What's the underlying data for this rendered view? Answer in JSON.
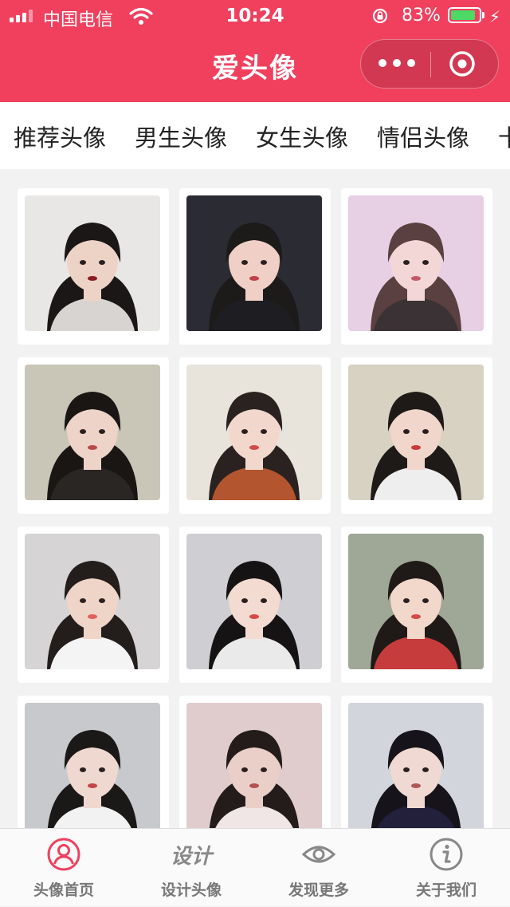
{
  "status_bar": {
    "carrier": "中国电信",
    "time": "10:24",
    "battery_percent": "83%",
    "battery_level": 0.83
  },
  "nav": {
    "title": "爱头像"
  },
  "tabs": [
    {
      "label": "推荐头像",
      "active": true
    },
    {
      "label": "男生头像",
      "active": false
    },
    {
      "label": "女生头像",
      "active": false
    },
    {
      "label": "情侣头像",
      "active": false
    },
    {
      "label": "卡",
      "active": false
    }
  ],
  "avatars": [
    {
      "name": "avatar-1",
      "bg": "#e9e7e5",
      "hair": "#1a1716",
      "skin": "#ecd3c6",
      "top": "#d8d4d2",
      "lip": "#8a1b22"
    },
    {
      "name": "avatar-2",
      "bg": "#2b2b33",
      "hair": "#1d1a1a",
      "skin": "#f0cfc6",
      "top": "#1e1e22",
      "lip": "#c1404a"
    },
    {
      "name": "avatar-3",
      "bg": "#e7cfe4",
      "hair": "#5a4040",
      "skin": "#f3d6d6",
      "top": "#3a3234",
      "lip": "#c25a6a"
    },
    {
      "name": "avatar-4",
      "bg": "#c9c6b8",
      "hair": "#191614",
      "skin": "#edd3c8",
      "top": "#2a2624",
      "lip": "#b84a4a"
    },
    {
      "name": "avatar-5",
      "bg": "#e8e4dc",
      "hair": "#2a2220",
      "skin": "#f2d8cc",
      "top": "#b3552e",
      "lip": "#d04a4a"
    },
    {
      "name": "avatar-6",
      "bg": "#d8d2c2",
      "hair": "#1e1a18",
      "skin": "#f1d6cb",
      "top": "#eeeeee",
      "lip": "#c83a3a"
    },
    {
      "name": "avatar-7",
      "bg": "#d6d4d4",
      "hair": "#231e1c",
      "skin": "#efd4c8",
      "top": "#f4f4f4",
      "lip": "#e0605a"
    },
    {
      "name": "avatar-8",
      "bg": "#cfcfd3",
      "hair": "#161314",
      "skin": "#f4dbd1",
      "top": "#eaeaea",
      "lip": "#d84848"
    },
    {
      "name": "avatar-9",
      "bg": "#9fa796",
      "hair": "#1f1a18",
      "skin": "#f2d7cb",
      "top": "#c63c3c",
      "lip": "#d34a4a"
    },
    {
      "name": "avatar-10",
      "bg": "#c7c9cc",
      "hair": "#1b1818",
      "skin": "#efd8cf",
      "top": "#f2f2f2",
      "lip": "#c54646"
    },
    {
      "name": "avatar-11",
      "bg": "#e1cccd",
      "hair": "#241c1b",
      "skin": "#eacfc8",
      "top": "#f1e6e6",
      "lip": "#b45050"
    },
    {
      "name": "avatar-12",
      "bg": "#d3d5dc",
      "hair": "#16141a",
      "skin": "#efd9d2",
      "top": "#22203a",
      "lip": "#b05858"
    }
  ],
  "bottom_tabs": [
    {
      "label": "头像首页",
      "icon": "user-circle-icon",
      "active": true
    },
    {
      "label": "设计头像",
      "icon": "design-text-icon",
      "icon_text": "设计",
      "active": false
    },
    {
      "label": "发现更多",
      "icon": "eye-icon",
      "active": false
    },
    {
      "label": "关于我们",
      "icon": "info-icon",
      "active": false
    }
  ],
  "colors": {
    "brand": "#f0405e",
    "active_text": "#f0405e",
    "inactive_text": "#777777",
    "battery_fill": "#4cd964"
  }
}
